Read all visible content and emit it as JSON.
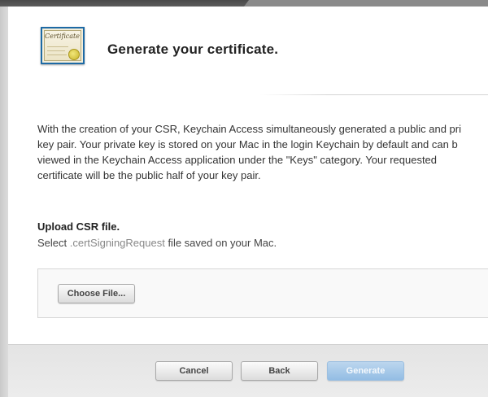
{
  "header": {
    "title": "Generate your certificate.",
    "icon": "certificate-icon",
    "icon_script_text": "Certificate"
  },
  "body": {
    "lines": [
      "With the creation of your CSR, Keychain Access simultaneously generated a public and pri",
      "key pair. Your private key is stored on your Mac in the login Keychain by default and can b",
      "viewed in the Keychain Access application under the \"Keys\" category. Your requested",
      "certificate will be the public half of your key pair."
    ]
  },
  "upload": {
    "heading": "Upload CSR file.",
    "instruction_prefix": "Select ",
    "instruction_ext": ".certSigningRequest",
    "instruction_suffix": " file saved on your Mac.",
    "choose_button_label": "Choose File..."
  },
  "footer": {
    "cancel_label": "Cancel",
    "back_label": "Back",
    "generate_label": "Generate"
  },
  "colors": {
    "accent_disabled": "#93bde4",
    "icon_border": "#1d6aa5"
  }
}
